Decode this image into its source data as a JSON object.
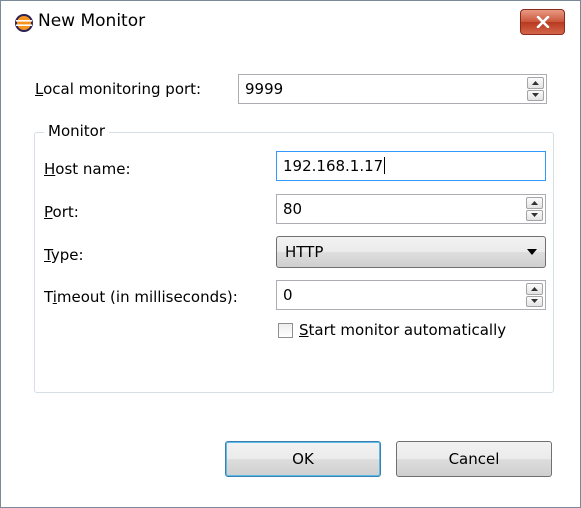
{
  "window": {
    "title": "New Monitor",
    "close_icon": "close-icon",
    "app_icon": "eclipse-icon"
  },
  "local_port": {
    "label_prefix": "L",
    "label_rest": "ocal monitoring port:",
    "value": "9999"
  },
  "monitor_group": {
    "title": "Monitor",
    "host": {
      "label_prefix": "H",
      "label_rest": "ost name:",
      "value": "192.168.1.17"
    },
    "port": {
      "label_prefix": "P",
      "label_rest": "ort:",
      "value": "80"
    },
    "type": {
      "label_prefix": "T",
      "label_rest": "ype:",
      "value": "HTTP"
    },
    "timeout": {
      "label_before": "T",
      "label_prefix": "i",
      "label_rest": "meout (in milliseconds):",
      "value": "0"
    },
    "auto_start": {
      "label_prefix": "S",
      "label_rest": "tart monitor automatically",
      "checked": false
    }
  },
  "buttons": {
    "ok": "OK",
    "cancel": "Cancel"
  },
  "colors": {
    "close_button": "#c9553a",
    "focus_border": "#3399ff",
    "default_button_border": "#3c7fb1"
  }
}
